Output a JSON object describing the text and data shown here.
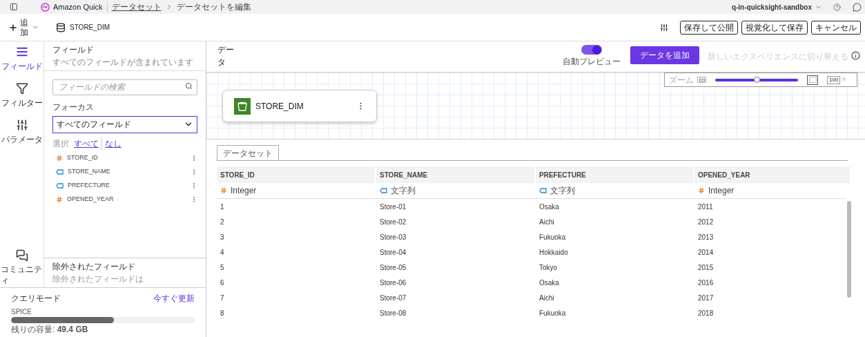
{
  "top_bar": {
    "product": "Amazon Quick",
    "breadcrumb": [
      {
        "label": "データセット",
        "link": true
      },
      {
        "label": "データセットを編集",
        "link": false
      }
    ],
    "account": "q-in-quicksight-sandbox"
  },
  "toolbar": {
    "add": "追加",
    "dataset_name": "STORE_DIM",
    "buttons": [
      "保存して公開",
      "視覚化して保存",
      "キャンセル"
    ]
  },
  "rail": [
    {
      "label": "フィールド",
      "selected": true
    },
    {
      "label": "フィルター",
      "selected": false
    },
    {
      "label": "パラメータ",
      "selected": false
    }
  ],
  "rail_bottom": [
    {
      "label": "コミュニティ",
      "selected": false
    }
  ],
  "fields_panel": {
    "title": "フィールド",
    "subtitle": "すべてのフィールドが含まれています",
    "search_placeholder": "フィールドの検索",
    "focus_label": "フォーカス",
    "focus_value": "すべてのフィールド",
    "select_label": "選択",
    "select_all": "すべて",
    "select_none": "なし",
    "fields": [
      {
        "name": "STORE_ID",
        "kind": "number"
      },
      {
        "name": "STORE_NAME",
        "kind": "text"
      },
      {
        "name": "PREFECTURE",
        "kind": "text"
      },
      {
        "name": "OPENED_YEAR",
        "kind": "number"
      }
    ],
    "excluded_title": "除外されたフィールド",
    "excluded_note": "除外されたフィールドは"
  },
  "query_mode": {
    "title": "クエリモード",
    "refresh": "今すぐ更新",
    "engine": "SPICE",
    "level": 0.56,
    "capacity_label": "残りの容量:",
    "capacity_value": "49.4 GB"
  },
  "data_header": {
    "title": "データ",
    "auto_preview_label": "自動プレビュー",
    "auto_preview_on": true,
    "add_data": "データを追加",
    "switch_experience": "新しいエクスペリエンスに切り替える"
  },
  "canvas": {
    "zoom_label": "ズーム",
    "zoom": {
      "level": 0.5
    },
    "zoom_value": "100",
    "zoom_unit": "%",
    "node": {
      "name": "STORE_DIM"
    }
  },
  "preview": {
    "tabs": [
      {
        "label": "データセット",
        "selected": true
      }
    ],
    "columns": [
      {
        "name": "STORE_ID",
        "kind": "number",
        "type": "Integer"
      },
      {
        "name": "STORE_NAME",
        "kind": "text",
        "type": "文字列"
      },
      {
        "name": "PREFECTURE",
        "kind": "text",
        "type": "文字列"
      },
      {
        "name": "OPENED_YEAR",
        "kind": "number",
        "type": "Integer"
      }
    ],
    "rows": [
      [
        "1",
        "Store-01",
        "Osaka",
        "2011"
      ],
      [
        "2",
        "Store-02",
        "Aichi",
        "2012"
      ],
      [
        "3",
        "Store-03",
        "Fukuoka",
        "2013"
      ],
      [
        "4",
        "Store-04",
        "Hokkaido",
        "2014"
      ],
      [
        "5",
        "Store-05",
        "Tokyo",
        "2015"
      ],
      [
        "6",
        "Store-06",
        "Osaka",
        "2016"
      ],
      [
        "7",
        "Store-07",
        "Aichi",
        "2017"
      ],
      [
        "8",
        "Store-08",
        "Fukuoka",
        "2018"
      ]
    ]
  }
}
